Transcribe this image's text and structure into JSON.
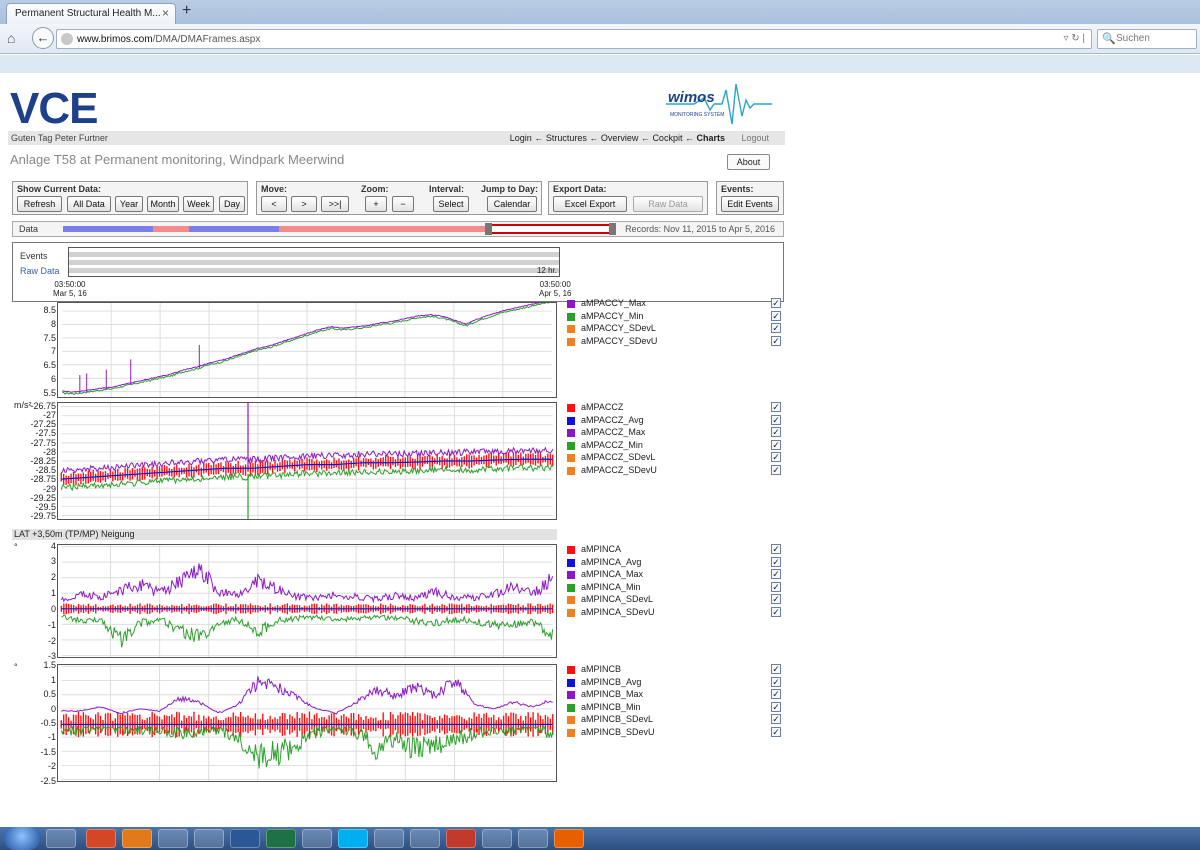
{
  "browser": {
    "tab_title": "Permanent Structural Health M...",
    "url_host": "www.brimos.com",
    "url_path": "/DMA/DMAFrames.aspx",
    "search_placeholder": "Suchen"
  },
  "header": {
    "logo": "VCE",
    "wimos_logo": "wimos",
    "wimos_sub": "MONITORING SYSTEM",
    "greeting": "Guten Tag Peter Furtner",
    "nav": [
      "Login",
      "Structures",
      "Overview",
      "Cockpit",
      "Charts"
    ],
    "nav_sep": "←",
    "logout": "Logout",
    "title": "Anlage T58 at Permanent monitoring, Windpark Meerwind",
    "about": "About"
  },
  "toolbar": {
    "show_current": {
      "title": "Show Current Data:",
      "buttons": [
        "Refresh",
        "All Data",
        "Year",
        "Month",
        "Week",
        "Day"
      ]
    },
    "move": {
      "title": "Move:",
      "buttons": [
        "<",
        ">",
        ">>|"
      ]
    },
    "zoom": {
      "title": "Zoom:",
      "in": "+",
      "out": "−"
    },
    "interval": {
      "title": "Interval:",
      "button": "Select"
    },
    "jump": {
      "title": "Jump to Day:",
      "button": "Calendar"
    },
    "export": {
      "title": "Export Data:",
      "excel": "Excel Export",
      "raw": "Raw Data"
    },
    "events": {
      "title": "Events:",
      "button": "Edit Events"
    }
  },
  "databar": {
    "label": "Data",
    "records": "Records: Nov 11, 2015 to Apr 5, 2016"
  },
  "overview": {
    "events_label": "Events",
    "raw_label": "Raw Data",
    "interval_label": "12 hr.",
    "start_time": "03:50:00",
    "start_date": "Mar 5, 16",
    "end_time": "03:50:00",
    "end_date": "Apr 5, 16"
  },
  "section": {
    "label": "LAT +3,50m (TP/MP)   Neigung"
  },
  "colors": {
    "red": "#ff1010",
    "blue": "#1010e0",
    "purple": "#8a18c8",
    "green": "#2aa02a",
    "orange": "#f08020"
  },
  "chart_data": [
    {
      "type": "line",
      "id": "accy",
      "unit": "",
      "yticks": [
        "8.5",
        "8",
        "7.5",
        "7",
        "6.5",
        "6",
        "5.5"
      ],
      "ylim": [
        5.3,
        8.8
      ],
      "legend": [
        {
          "name": "aMPACCY_Max",
          "color": "#8a18c8",
          "checked": true
        },
        {
          "name": "aMPACCY_Min",
          "color": "#2aa02a",
          "checked": true
        },
        {
          "name": "aMPACCY_SDevL",
          "color": "#f08020",
          "checked": true
        },
        {
          "name": "aMPACCY_SDevU",
          "color": "#f08020",
          "checked": true
        }
      ],
      "series_y": [
        5.45,
        5.42,
        5.48,
        5.55,
        5.6,
        5.7,
        5.8,
        5.9,
        6.0,
        6.1,
        6.25,
        6.35,
        6.5,
        6.6,
        6.75,
        6.9,
        7.05,
        7.15,
        7.3,
        7.45,
        7.6,
        7.75,
        7.85,
        7.8,
        7.85,
        7.9,
        8.0,
        8.05,
        8.15,
        8.25,
        8.3,
        8.25,
        8.1,
        7.95,
        8.15,
        8.3,
        8.45,
        8.55,
        8.65,
        8.75,
        8.85
      ]
    },
    {
      "type": "area",
      "id": "accz",
      "unit": "m/s²",
      "yticks": [
        "-26.75",
        "-27",
        "-27.25",
        "-27.5",
        "-27.75",
        "-28",
        "-28.25",
        "-28.5",
        "-28.75",
        "-29",
        "-29.25",
        "-29.5",
        "-29.75"
      ],
      "ylim": [
        -29.85,
        -26.65
      ],
      "legend": [
        {
          "name": "aMPACCZ",
          "color": "#ff1010",
          "checked": true
        },
        {
          "name": "aMPACCZ_Avg",
          "color": "#1010e0",
          "checked": true
        },
        {
          "name": "aMPACCZ_Max",
          "color": "#8a18c8",
          "checked": true
        },
        {
          "name": "aMPACCZ_Min",
          "color": "#2aa02a",
          "checked": true
        },
        {
          "name": "aMPACCZ_SDevL",
          "color": "#f08020",
          "checked": true
        },
        {
          "name": "aMPACCZ_SDevU",
          "color": "#f08020",
          "checked": true
        }
      ],
      "avg": [
        -28.75,
        -28.7,
        -28.65,
        -28.6,
        -28.55,
        -28.5,
        -28.45,
        -28.45,
        -28.4,
        -28.35,
        -28.35,
        -28.3,
        -28.3,
        -28.28,
        -28.25,
        -28.25,
        -28.22,
        -28.2,
        -28.2
      ],
      "spread": 0.3
    },
    {
      "type": "area",
      "id": "inca",
      "unit": "°",
      "yticks": [
        "4",
        "3",
        "2",
        "1",
        "0",
        "-1",
        "-2",
        "-3"
      ],
      "ylim": [
        -3.1,
        4.1
      ],
      "legend": [
        {
          "name": "aMPINCA",
          "color": "#ff1010",
          "checked": true
        },
        {
          "name": "aMPINCA_Avg",
          "color": "#1010e0",
          "checked": true
        },
        {
          "name": "aMPINCA_Max",
          "color": "#8a18c8",
          "checked": true
        },
        {
          "name": "aMPINCA_Min",
          "color": "#2aa02a",
          "checked": true
        },
        {
          "name": "aMPINCA_SDevL",
          "color": "#f08020",
          "checked": true
        },
        {
          "name": "aMPINCA_SDevU",
          "color": "#f08020",
          "checked": true
        }
      ],
      "max_env": [
        0.8,
        1.2,
        1.0,
        1.5,
        2.0,
        1.3,
        2.2,
        3.6,
        1.4,
        1.1,
        2.3,
        1.6,
        1.0,
        0.9,
        1.2,
        1.0,
        0.8,
        1.1,
        0.9,
        1.4,
        1.0,
        0.9,
        1.2,
        1.8,
        1.2,
        2.5
      ],
      "min_env": [
        -0.6,
        -1.0,
        -0.9,
        -2.6,
        -1.2,
        -0.9,
        -1.7,
        -2.4,
        -1.1,
        -0.9,
        -1.9,
        -1.0,
        -0.8,
        -0.7,
        -0.9,
        -0.8,
        -0.7,
        -0.8,
        -1.0,
        -1.2,
        -0.9,
        -1.0,
        -1.4,
        -1.3,
        -1.1,
        -2.2
      ]
    },
    {
      "type": "area",
      "id": "incb",
      "unit": "°",
      "yticks": [
        "1.5",
        "1",
        "0.5",
        "0",
        "-0.5",
        "-1",
        "-1.5",
        "-2",
        "-2.5"
      ],
      "ylim": [
        -2.55,
        1.55
      ],
      "legend": [
        {
          "name": "aMPINCB",
          "color": "#ff1010",
          "checked": true
        },
        {
          "name": "aMPINCB_Avg",
          "color": "#1010e0",
          "checked": true
        },
        {
          "name": "aMPINCB_Max",
          "color": "#8a18c8",
          "checked": true
        },
        {
          "name": "aMPINCB_Min",
          "color": "#2aa02a",
          "checked": true
        },
        {
          "name": "aMPINCB_SDevL",
          "color": "#f08020",
          "checked": true
        },
        {
          "name": "aMPINCB_SDevU",
          "color": "#f08020",
          "checked": true
        }
      ],
      "max_env": [
        -0.1,
        -0.1,
        0.1,
        -0.2,
        0.0,
        -0.1,
        0.5,
        0.3,
        -0.2,
        0.2,
        1.2,
        1.0,
        0.5,
        0.0,
        -0.2,
        0.3,
        0.9,
        0.6,
        1.0,
        0.6,
        1.3,
        0.2,
        0.0,
        0.3,
        0.1,
        0.4
      ],
      "min_env": [
        -0.9,
        -1.1,
        -0.8,
        -0.9,
        -1.0,
        -0.9,
        -1.2,
        -1.0,
        -0.9,
        -1.3,
        -2.2,
        -2.0,
        -1.7,
        -1.0,
        -0.9,
        -1.1,
        -1.8,
        -1.3,
        -1.9,
        -1.6,
        -1.5,
        -1.1,
        -0.9,
        -1.0,
        -0.8,
        -1.2
      ],
      "avg": -0.55
    }
  ]
}
